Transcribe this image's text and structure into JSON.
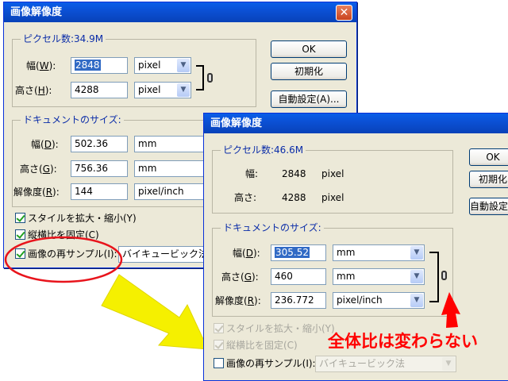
{
  "dialog1": {
    "title": "画像解像度",
    "pixel_group": {
      "label": "ピクセル数:34.9M",
      "width_label": "幅(",
      "width_key": "W",
      "width_value": "2848",
      "width_unit": "pixel",
      "height_label": "高さ(",
      "height_key": "H",
      "height_value": "4288",
      "height_unit": "pixel"
    },
    "doc_group": {
      "label": "ドキュメントのサイズ:",
      "width_label": "幅(",
      "width_key": "D",
      "width_value": "502.36",
      "width_unit": "mm",
      "height_label": "高さ(",
      "height_key": "G",
      "height_value": "756.36",
      "height_unit": "mm",
      "res_label": "解像度(",
      "res_key": "R",
      "res_value": "144",
      "res_unit": "pixel/inch"
    },
    "buttons": {
      "ok": "OK",
      "reset": "初期化",
      "auto": "自動設定(A)..."
    },
    "checks": {
      "scale_styles": "スタイルを拡大・縮小(Y)",
      "constrain": "縦横比を固定(C)",
      "resample": "画像の再サンプル(I):",
      "resample_method": "バイキュービック法"
    }
  },
  "dialog2": {
    "title": "画像解像度",
    "pixel_group": {
      "label": "ピクセル数:46.6M",
      "width_label": "幅:",
      "width_value": "2848",
      "width_unit": "pixel",
      "height_label": "高さ:",
      "height_value": "4288",
      "height_unit": "pixel"
    },
    "doc_group": {
      "label": "ドキュメントのサイズ:",
      "width_label": "幅(",
      "width_key": "D",
      "width_value": "305.52",
      "width_unit": "mm",
      "height_label": "高さ(",
      "height_key": "G",
      "height_value": "460",
      "height_unit": "mm",
      "res_label": "解像度(",
      "res_key": "R",
      "res_value": "236.772",
      "res_unit": "pixel/inch"
    },
    "buttons": {
      "ok": "OK",
      "reset": "初期化",
      "auto": "自動設定(A)..."
    },
    "checks": {
      "scale_styles": "スタイルを拡大・縮小(Y)",
      "constrain": "縦横比を固定(C)",
      "resample": "画像の再サンプル(I):",
      "resample_method": "バイキュービック法"
    }
  },
  "annotation": {
    "note": "全体比は変わらない",
    "colors": {
      "circle": "#e8141c",
      "arrow_yellow": "#f5f000",
      "arrow_red": "#ff0000"
    }
  }
}
